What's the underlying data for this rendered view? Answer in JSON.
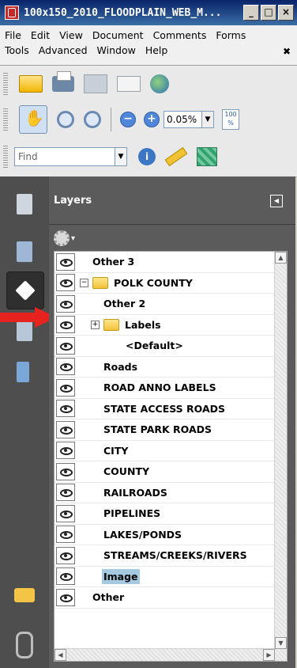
{
  "window": {
    "title": "100x150_2010_FLOODPLAIN_WEB_M..."
  },
  "menu": {
    "row1": [
      "File",
      "Edit",
      "View",
      "Document",
      "Comments",
      "Forms"
    ],
    "row2": [
      "Tools",
      "Advanced",
      "Window",
      "Help"
    ]
  },
  "toolbar": {
    "zoom_value": "0.05%",
    "find_placeholder": "Find",
    "pct_icon_text": "100 %"
  },
  "panel": {
    "title": "Layers"
  },
  "layers": [
    {
      "name": "Other 3",
      "indent": 0,
      "folder": false,
      "expander": "",
      "selected": false
    },
    {
      "name": "POLK COUNTY",
      "indent": 0,
      "folder": true,
      "expander": "−",
      "selected": false
    },
    {
      "name": "Other 2",
      "indent": 1,
      "folder": false,
      "expander": "",
      "selected": false
    },
    {
      "name": "Labels",
      "indent": 1,
      "folder": true,
      "expander": "+",
      "selected": false
    },
    {
      "name": "<Default>",
      "indent": 2,
      "folder": false,
      "expander": "",
      "selected": false
    },
    {
      "name": "Roads",
      "indent": 1,
      "folder": false,
      "expander": "",
      "selected": false
    },
    {
      "name": "ROAD ANNO LABELS",
      "indent": 1,
      "folder": false,
      "expander": "",
      "selected": false
    },
    {
      "name": "STATE ACCESS ROADS",
      "indent": 1,
      "folder": false,
      "expander": "",
      "selected": false
    },
    {
      "name": "STATE PARK ROADS",
      "indent": 1,
      "folder": false,
      "expander": "",
      "selected": false
    },
    {
      "name": "CITY",
      "indent": 1,
      "folder": false,
      "expander": "",
      "selected": false
    },
    {
      "name": "COUNTY",
      "indent": 1,
      "folder": false,
      "expander": "",
      "selected": false
    },
    {
      "name": "RAILROADS",
      "indent": 1,
      "folder": false,
      "expander": "",
      "selected": false
    },
    {
      "name": "PIPELINES",
      "indent": 1,
      "folder": false,
      "expander": "",
      "selected": false
    },
    {
      "name": "LAKES/PONDS",
      "indent": 1,
      "folder": false,
      "expander": "",
      "selected": false
    },
    {
      "name": "STREAMS/CREEKS/RIVERS",
      "indent": 1,
      "folder": false,
      "expander": "",
      "selected": false
    },
    {
      "name": "Image",
      "indent": 1,
      "folder": false,
      "expander": "",
      "selected": true
    },
    {
      "name": "Other",
      "indent": 0,
      "folder": false,
      "expander": "",
      "selected": false
    }
  ],
  "colors": {
    "title_bar": "#0a246a",
    "selection": "#a6c9e2",
    "panel_bg": "#5b5b5b",
    "arrow": "#e6231f"
  }
}
